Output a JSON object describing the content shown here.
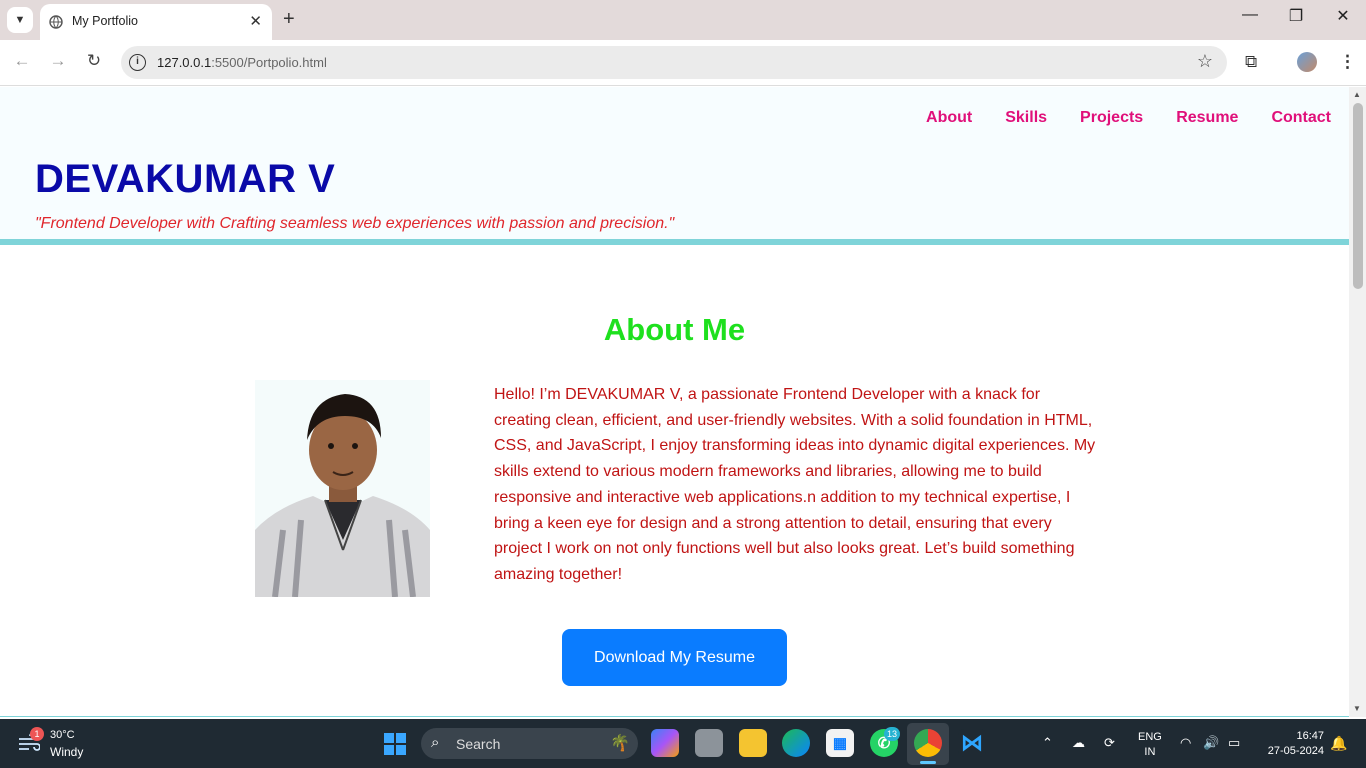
{
  "browser": {
    "tab_title": "My Portfolio",
    "url_host": "127.0.0.1",
    "url_rest": ":5500/Portpolio.html"
  },
  "site": {
    "nav": [
      "About",
      "Skills",
      "Projects",
      "Resume",
      "Contact"
    ],
    "name": "DEVAKUMAR V",
    "tagline": "\"Frontend Developer with Crafting seamless web experiences with passion and precision.\"",
    "about_title": "About Me",
    "about_text": "Hello! I’m DEVAKUMAR V, a passionate Frontend Developer with a knack for creating clean, efficient, and user-friendly websites. With a solid foundation in HTML, CSS, and JavaScript, I enjoy transforming ideas into dynamic digital experiences. My skills extend to various modern frameworks and libraries, allowing me to build responsive and interactive web applications.n addition to my technical expertise, I bring a keen eye for design and a strong attention to detail, ensuring that every project I work on not only functions well but also looks great. Let’s build something amazing together!",
    "resume_button": "Download My Resume"
  },
  "taskbar": {
    "weather_badge": "1",
    "weather_temp": "30°C",
    "weather_desc": "Windy",
    "search_label": "Search",
    "whatsapp_badge": "13",
    "lang_top": "ENG",
    "lang_bottom": "IN",
    "time": "16:47",
    "date": "27-05-2024"
  },
  "colors": {
    "nav_link": "#e0107a",
    "site_name": "#0a0aa8",
    "tagline": "#e0262c",
    "about_title": "#1ee01e",
    "about_text": "#c01414",
    "resume_button": "#0a7cff",
    "header_border": "#7fd4d9"
  }
}
